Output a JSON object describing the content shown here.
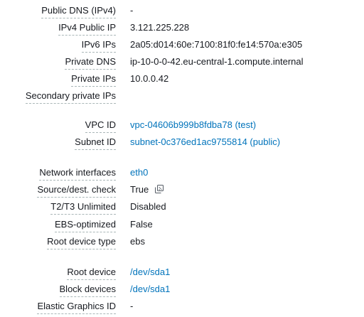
{
  "details": [
    {
      "label": "Public DNS (IPv4)",
      "value": "-",
      "link": false
    },
    {
      "label": "IPv4 Public IP",
      "value": "3.121.225.228",
      "link": false
    },
    {
      "label": "IPv6 IPs",
      "value": "2a05:d014:60e:7100:81f0:fe14:570a:e305",
      "link": false
    },
    {
      "label": "Private DNS",
      "value": "ip-10-0-0-42.eu-central-1.compute.internal",
      "link": false
    },
    {
      "label": "Private IPs",
      "value": "10.0.0.42",
      "link": false
    },
    {
      "label": "Secondary private IPs",
      "value": "",
      "link": false
    },
    {
      "label": "VPC ID",
      "value": "vpc-04606b999b8fdba78 (test)",
      "link": true
    },
    {
      "label": "Subnet ID",
      "value": "subnet-0c376ed1ac9755814 (public)",
      "link": true
    },
    {
      "label": "Network interfaces",
      "value": "eth0",
      "link": true
    },
    {
      "label": "Source/dest. check",
      "value": "True",
      "link": false,
      "icon": "copy-icon"
    },
    {
      "label": "T2/T3 Unlimited",
      "value": "Disabled",
      "link": false
    },
    {
      "label": "EBS-optimized",
      "value": "False",
      "link": false
    },
    {
      "label": "Root device type",
      "value": "ebs",
      "link": false
    },
    {
      "label": "Root device",
      "value": "/dev/sda1",
      "link": true
    },
    {
      "label": "Block devices",
      "value": "/dev/sda1",
      "link": true
    },
    {
      "label": "Elastic Graphics ID",
      "value": "-",
      "link": false
    }
  ],
  "colors": {
    "text": "#16191f",
    "link": "#0073bb",
    "dashed_underline": "#aab7b8"
  }
}
